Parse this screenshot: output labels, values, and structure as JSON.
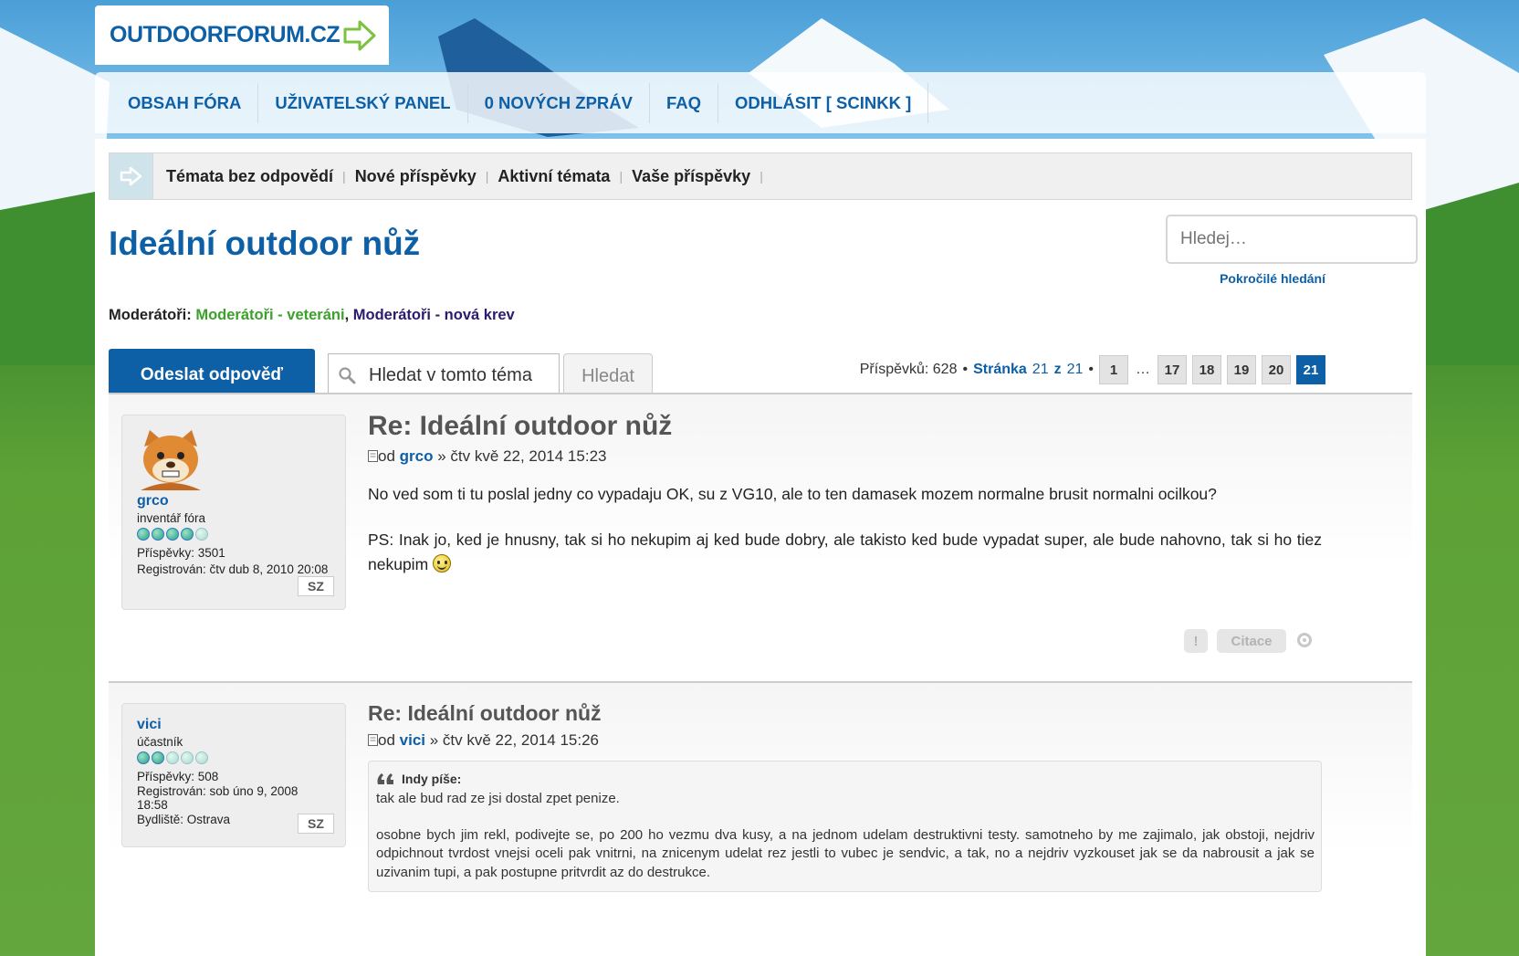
{
  "logo": {
    "text": "OUTDOORFORUM.CZ"
  },
  "nav": {
    "items": [
      "OBSAH FÓRA",
      "UŽIVATELSKÝ PANEL",
      "0 NOVÝCH ZPRÁV",
      "FAQ",
      "ODHLÁSIT [ SCINKK ]"
    ]
  },
  "quick_links": [
    "Témata bez odpovědí",
    "Nové příspěvky",
    "Aktivní témata",
    "Vaše příspěvky"
  ],
  "topic": {
    "title": "Ideální outdoor nůž"
  },
  "search": {
    "placeholder": "Hledej…",
    "advanced": "Pokročilé hledání"
  },
  "moderators": {
    "label": "Moderátoři:",
    "group1": "Moderátoři - veteráni",
    "separator": ",",
    "group2": "Moderátoři - nová krev"
  },
  "actions": {
    "reply": "Odeslat odpověď",
    "topic_search": "Hledat v tomto téma",
    "search_button": "Hledat"
  },
  "pagination": {
    "posts_label": "Příspěvků: 628",
    "bullet": "•",
    "page_label": "Stránka",
    "current": "21",
    "of": "z",
    "total": "21",
    "ellipsis": "…",
    "pages": [
      "1",
      "17",
      "18",
      "19",
      "20",
      "21"
    ]
  },
  "posts": [
    {
      "title": "Re: Ideální outdoor nůž",
      "meta_prefix": "od",
      "author": "grco",
      "meta_suffix": "» čtv kvě 22, 2014 15:23",
      "profile": {
        "username": "grco",
        "rank": "inventář fóra",
        "rank_level": 4,
        "posts": "Příspěvky: 3501",
        "registered": "Registrován: čtv dub 8, 2010 20:08",
        "pm": "SZ"
      },
      "paragraph1": "No ved som ti tu poslal jedny co vypadaju OK, su z VG10, ale to ten damasek mozem normalne brusit normalni ocilkou?",
      "paragraph2": "PS: Inak jo, ked je hnusny, tak si ho nekupim aj ked bude dobry, ale takisto ked bude vypadat super, ale bude nahovno, tak si ho tiez nekupim",
      "report_btn": "!",
      "quote_btn": "Citace"
    },
    {
      "title": "Re: Ideální outdoor nůž",
      "meta_prefix": "od",
      "author": "vici",
      "meta_suffix": "» čtv kvě 22, 2014 15:26",
      "profile": {
        "username": "vici",
        "rank": "účastník",
        "rank_level": 2,
        "posts": "Příspěvky: 508",
        "registered": "Registrován: sob úno 9, 2008 18:58",
        "location": "Bydliště: Ostrava",
        "pm": "SZ"
      },
      "quote": {
        "cite": "Indy píše:",
        "line1": "tak ale bud rad ze jsi dostal zpet penize.",
        "line2": "osobne bych jim rekl, podivejte se, po 200 ho vezmu dva kusy, a na jednom udelam destruktivni testy. samotneho by me zajimalo, jak obstoji, nejdriv odpichnout tvrdost vnejsi oceli pak vnitrni, na znicenym udelat rez jestli to vubec je sendvic, a tak, no a nejdriv vyzkouset jak se da nabrousit a jak se uzivanim tupi, a pak postupne pritvrdit az do destrukce."
      }
    }
  ],
  "colors": {
    "brand": "#0d5fa6",
    "moderator_veterans": "#3ba12b",
    "moderator_new": "#2c1a6e"
  }
}
